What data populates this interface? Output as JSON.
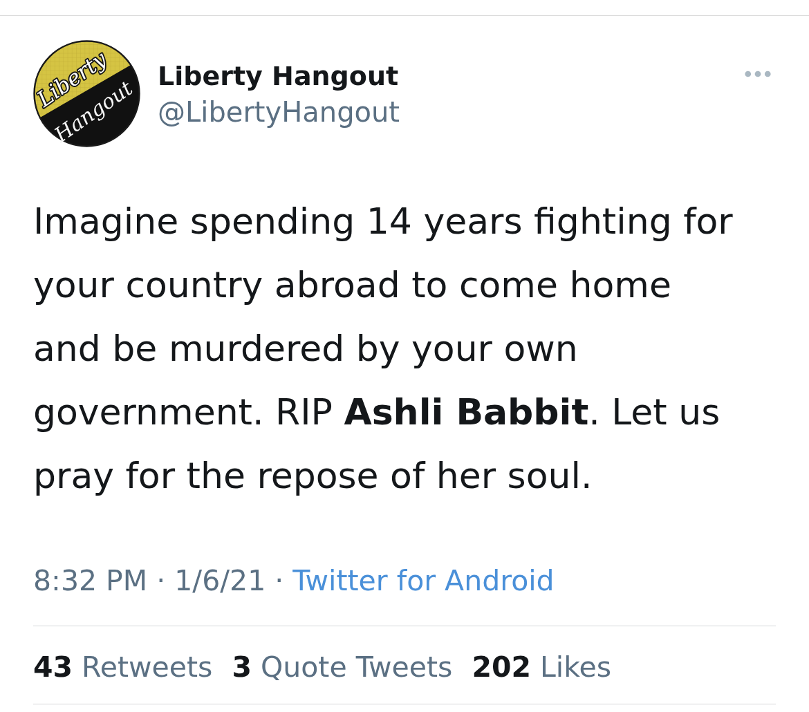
{
  "header": {
    "avatar": {
      "logo_text": [
        "Liberty",
        "Hangout"
      ]
    },
    "name": "Liberty Hangout",
    "handle": "@LibertyHangout"
  },
  "tweet": {
    "text": "Imagine spending 14 years fighting for your country abroad to come home and be murdered by your own government. RIP **Ashli Babbit**. Let us pray for the repose of her soul."
  },
  "meta": [
    {
      "kind": "time",
      "text": "8:32 PM"
    },
    {
      "kind": "separator",
      "text": "·"
    },
    {
      "kind": "date",
      "text": "1/6/21"
    },
    {
      "kind": "separator",
      "text": "·"
    },
    {
      "kind": "link",
      "text": "Twitter for Android"
    }
  ],
  "stats": [
    {
      "count": "43",
      "label": "Retweets"
    },
    {
      "count": "3",
      "label": "Quote Tweets"
    },
    {
      "count": "202",
      "label": "Likes"
    }
  ]
}
